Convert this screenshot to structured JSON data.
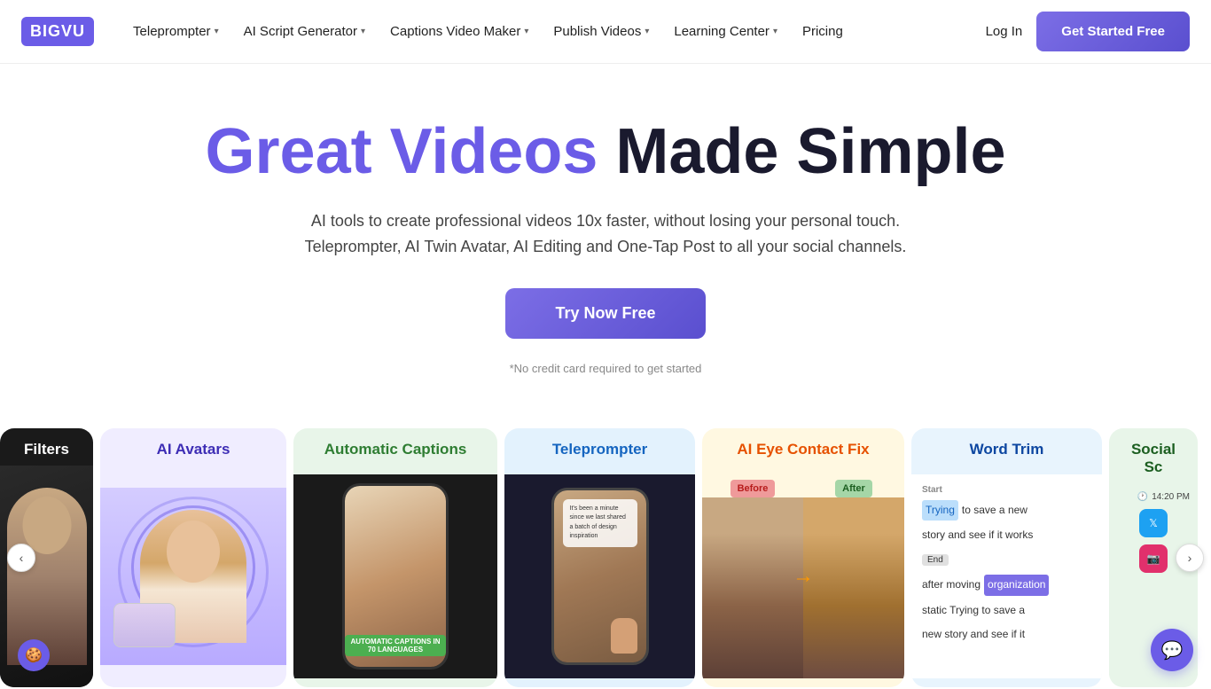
{
  "logo": {
    "text": "BIGVU"
  },
  "nav": {
    "items": [
      {
        "label": "Teleprompter",
        "hasDropdown": true
      },
      {
        "label": "AI Script Generator",
        "hasDropdown": true
      },
      {
        "label": "Captions Video Maker",
        "hasDropdown": true
      },
      {
        "label": "Publish Videos",
        "hasDropdown": true
      },
      {
        "label": "Learning Center",
        "hasDropdown": true
      },
      {
        "label": "Pricing",
        "hasDropdown": false
      }
    ],
    "login_label": "Log In",
    "cta_label": "Get Started Free"
  },
  "hero": {
    "title_prefix": "Great Videos ",
    "title_highlight": "Made Simple",
    "subtitle": "AI tools to create professional videos 10x faster, without losing your personal touch. Teleprompter, AI Twin Avatar, AI Editing and One-Tap Post to all your social channels.",
    "cta_label": "Try Now Free",
    "no_card_text": "*No credit card required to get started"
  },
  "cards": [
    {
      "id": "filters",
      "label": "Filters",
      "bg": "#1a1a1a"
    },
    {
      "id": "ai-avatars",
      "label": "AI Avatars",
      "bg": "#f0edff"
    },
    {
      "id": "automatic-captions",
      "label": "Automatic Captions",
      "bg": "#e8f5e9"
    },
    {
      "id": "teleprompter",
      "label": "Teleprompter",
      "bg": "#e3f2fd"
    },
    {
      "id": "ai-eye-contact",
      "label": "AI Eye Contact Fix",
      "bg": "#fff8e1"
    },
    {
      "id": "word-trim",
      "label": "Word Trim",
      "bg": "#e8f4fd"
    },
    {
      "id": "social",
      "label": "Social Sc",
      "bg": "#e8f5e9"
    }
  ],
  "wordtrim": {
    "start_label": "Start",
    "row1": [
      "Trying",
      "to save a new"
    ],
    "row2": [
      "story and see if it works"
    ],
    "end_label": "End",
    "row3": [
      "after moving",
      "organization"
    ],
    "row4": [
      "static Trying to save a"
    ],
    "row5": [
      "new story and see if it"
    ]
  },
  "captions_badge": "AUTOMATIC CAPTIONS IN 70 LANGUAGES",
  "eye_before": "Before",
  "eye_after": "After",
  "social_time": "14:20 PM",
  "teleprompter_text": "It's been a minute since we last shared a batch of design inspiration",
  "nav_prev_label": "‹",
  "nav_next_label": "›"
}
